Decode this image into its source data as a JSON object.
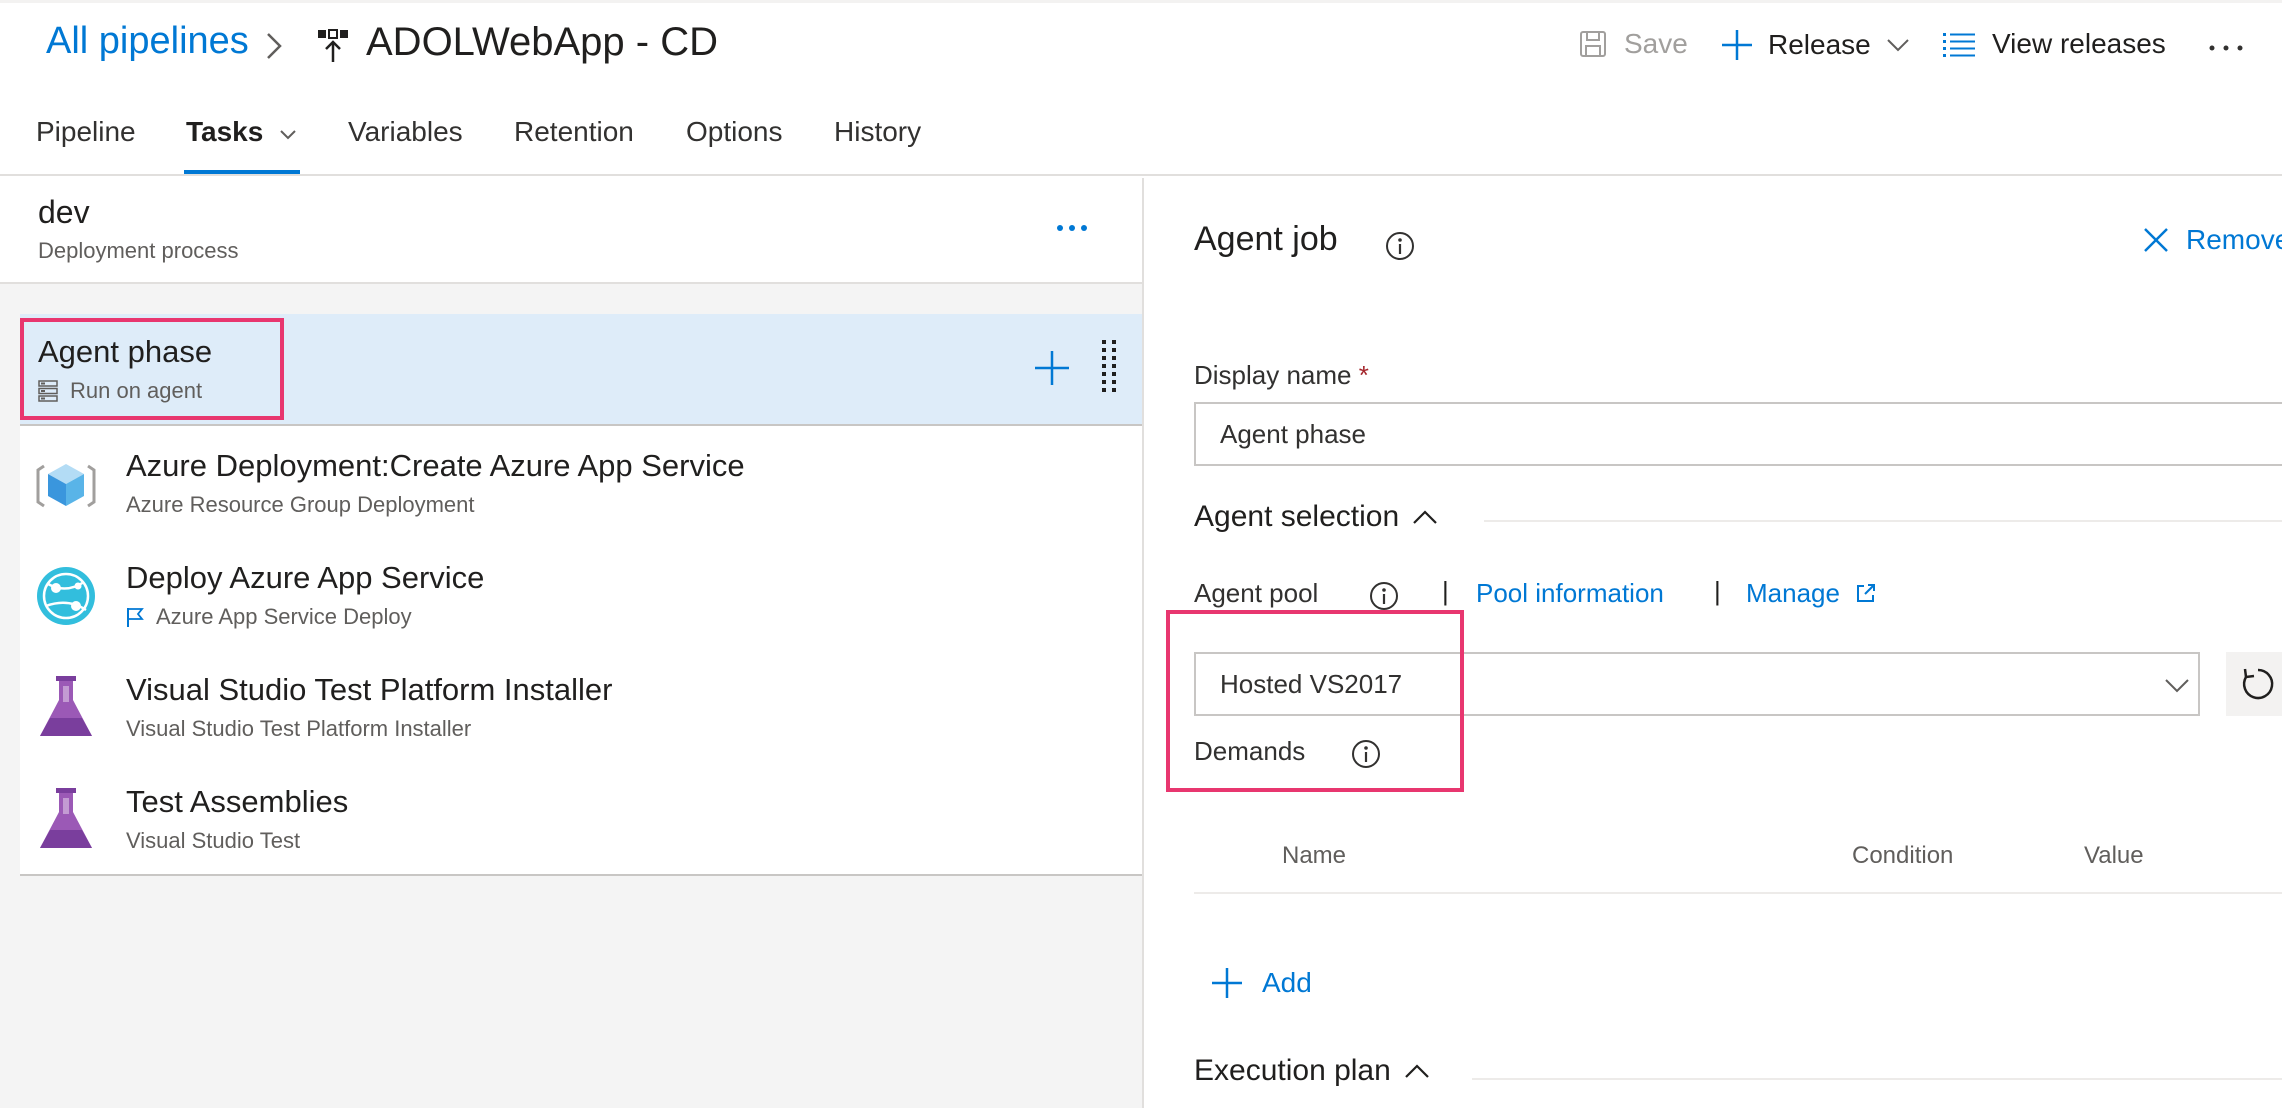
{
  "header": {
    "breadcrumb_link": "All pipelines",
    "pipeline_title": "ADOLWebApp - CD",
    "save_label": "Save",
    "release_label": "Release",
    "view_releases_label": "View releases"
  },
  "tabs": [
    {
      "label": "Pipeline"
    },
    {
      "label": "Tasks"
    },
    {
      "label": "Variables"
    },
    {
      "label": "Retention"
    },
    {
      "label": "Options"
    },
    {
      "label": "History"
    }
  ],
  "stage": {
    "name": "dev",
    "subtitle": "Deployment process"
  },
  "phase": {
    "name": "Agent phase",
    "subtitle": "Run on agent"
  },
  "tasks": [
    {
      "name": "Azure Deployment:Create Azure App Service",
      "subtitle": "Azure Resource Group Deployment",
      "icon": "azure-resource-group-icon"
    },
    {
      "name": "Deploy Azure App Service",
      "subtitle": "Azure App Service Deploy",
      "icon": "azure-app-service-icon"
    },
    {
      "name": "Visual Studio Test Platform Installer",
      "subtitle": "Visual Studio Test Platform Installer",
      "icon": "flask-icon"
    },
    {
      "name": "Test Assemblies",
      "subtitle": "Visual Studio Test",
      "icon": "flask-icon"
    }
  ],
  "details": {
    "title": "Agent job",
    "remove_label": "Remove",
    "display_name_label": "Display name",
    "required_mark": "*",
    "display_name_value": "Agent phase",
    "agent_selection_label": "Agent selection",
    "agent_pool_label": "Agent pool",
    "separator": "|",
    "pool_information_label": "Pool information",
    "manage_label": "Manage",
    "agent_pool_value": "Hosted VS2017",
    "demands_label": "Demands",
    "columns": [
      "Name",
      "Condition",
      "Value"
    ],
    "add_label": "Add",
    "execution_plan_label": "Execution plan"
  },
  "colors": {
    "accent": "#0078d4",
    "highlight": "#e8366f",
    "selected_row": "#deecf9",
    "flask": "#7a3e9d"
  }
}
